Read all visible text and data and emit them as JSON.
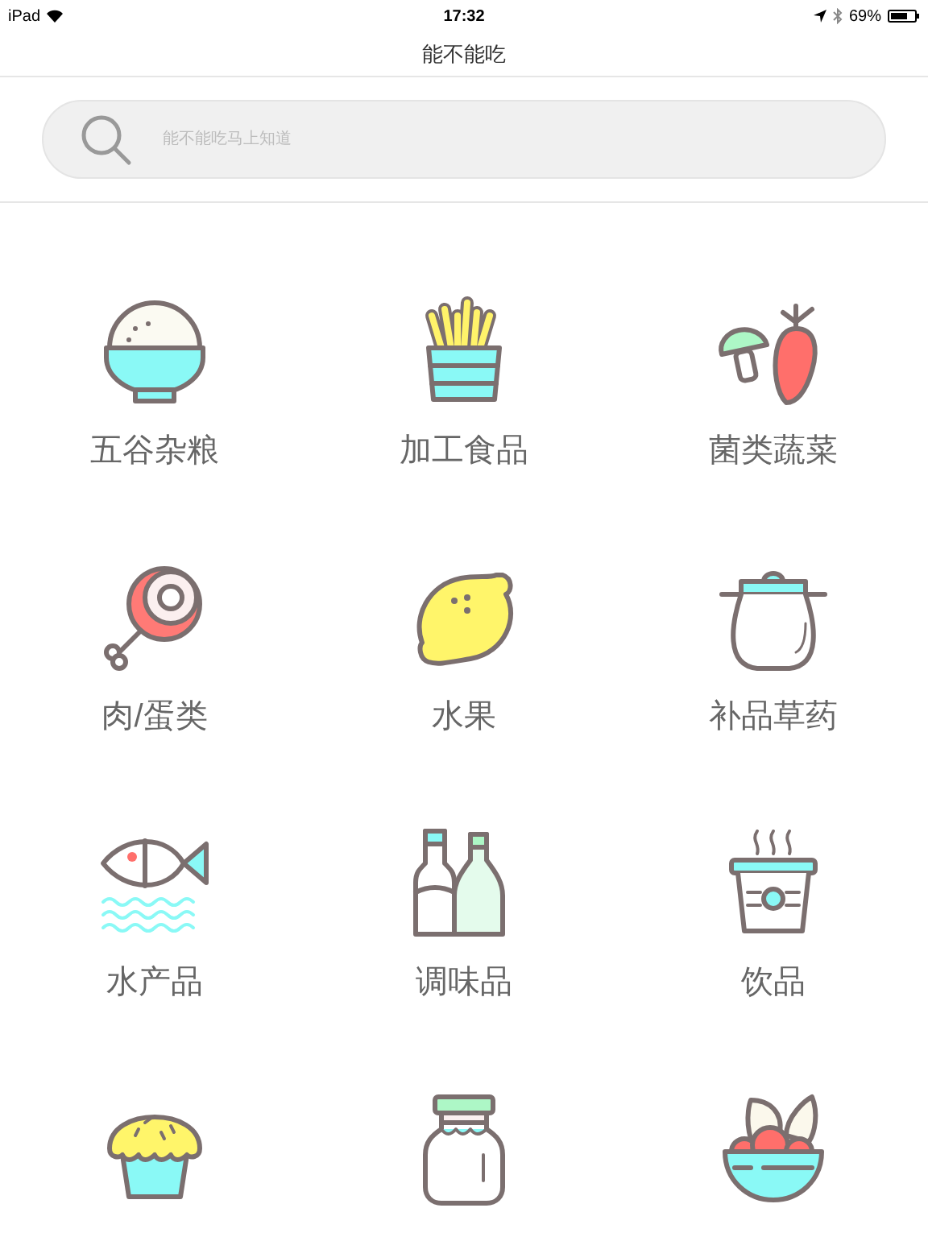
{
  "status_bar": {
    "device": "iPad",
    "time": "17:32",
    "battery": "69%"
  },
  "nav": {
    "title": "能不能吃"
  },
  "search": {
    "placeholder": "能不能吃马上知道"
  },
  "categories": [
    {
      "kind": "rice",
      "label": "五谷杂粮"
    },
    {
      "kind": "fries",
      "label": "加工食品"
    },
    {
      "kind": "veg",
      "label": "菌类蔬菜"
    },
    {
      "kind": "meat",
      "label": "肉/蛋类"
    },
    {
      "kind": "lemon",
      "label": "水果"
    },
    {
      "kind": "pot",
      "label": "补品草药"
    },
    {
      "kind": "fish",
      "label": "水产品"
    },
    {
      "kind": "bottles",
      "label": "调味品"
    },
    {
      "kind": "drink",
      "label": "饮品"
    },
    {
      "kind": "muffin"
    },
    {
      "kind": "jar"
    },
    {
      "kind": "bowl"
    }
  ]
}
